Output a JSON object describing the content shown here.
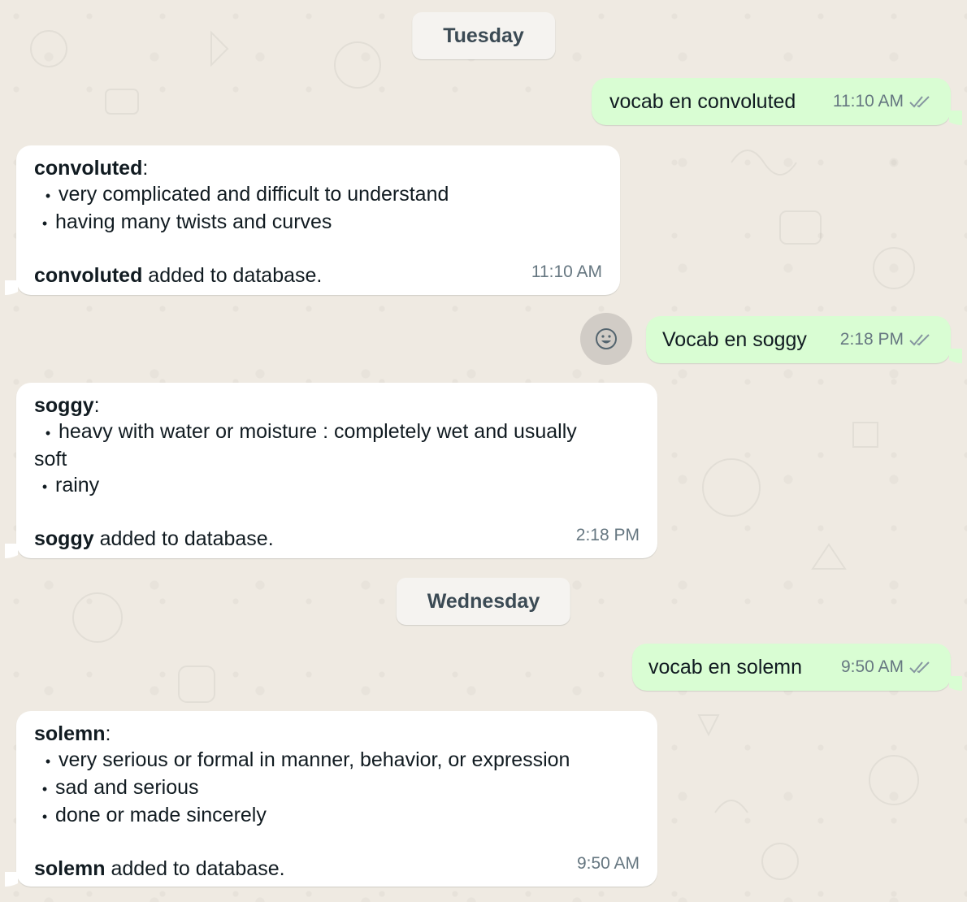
{
  "days": {
    "tuesday": "Tuesday",
    "wednesday": "Wednesday"
  },
  "messages": {
    "m1": {
      "text": "vocab en convoluted",
      "time": "11:10 AM",
      "status": "read"
    },
    "m2": {
      "term": "convoluted",
      "colon": ":",
      "bullets": [
        "very complicated and difficult to understand",
        "having many twists and curves"
      ],
      "added_term": "convoluted",
      "added_suffix": " added to database.",
      "time": "11:10 AM"
    },
    "m3": {
      "text": "Vocab en soggy",
      "time": "2:18 PM",
      "status": "read"
    },
    "m4": {
      "term": "soggy",
      "colon": ":",
      "bullet1": "heavy with water or moisture : completely wet and usually",
      "bullet1_cont": "soft",
      "bullet2": "rainy",
      "added_term": "soggy",
      "added_suffix": " added to database.",
      "time": "2:18 PM"
    },
    "m5": {
      "text": "vocab en solemn",
      "time": "9:50 AM",
      "status": "read"
    },
    "m6": {
      "term": "solemn",
      "colon": ":",
      "bullets": [
        "very serious or formal in manner, behavior, or expression",
        "sad and serious",
        "done or made sincerely"
      ],
      "added_term": "solemn",
      "added_suffix": " added to database.",
      "time": "9:50 AM"
    }
  },
  "icons": {
    "reaction": "emoji-smile-icon",
    "read_receipt": "double-check-icon"
  },
  "colors": {
    "background": "#efeae2",
    "outgoing": "#d9fdd3",
    "incoming": "#ffffff",
    "meta": "#667781"
  }
}
